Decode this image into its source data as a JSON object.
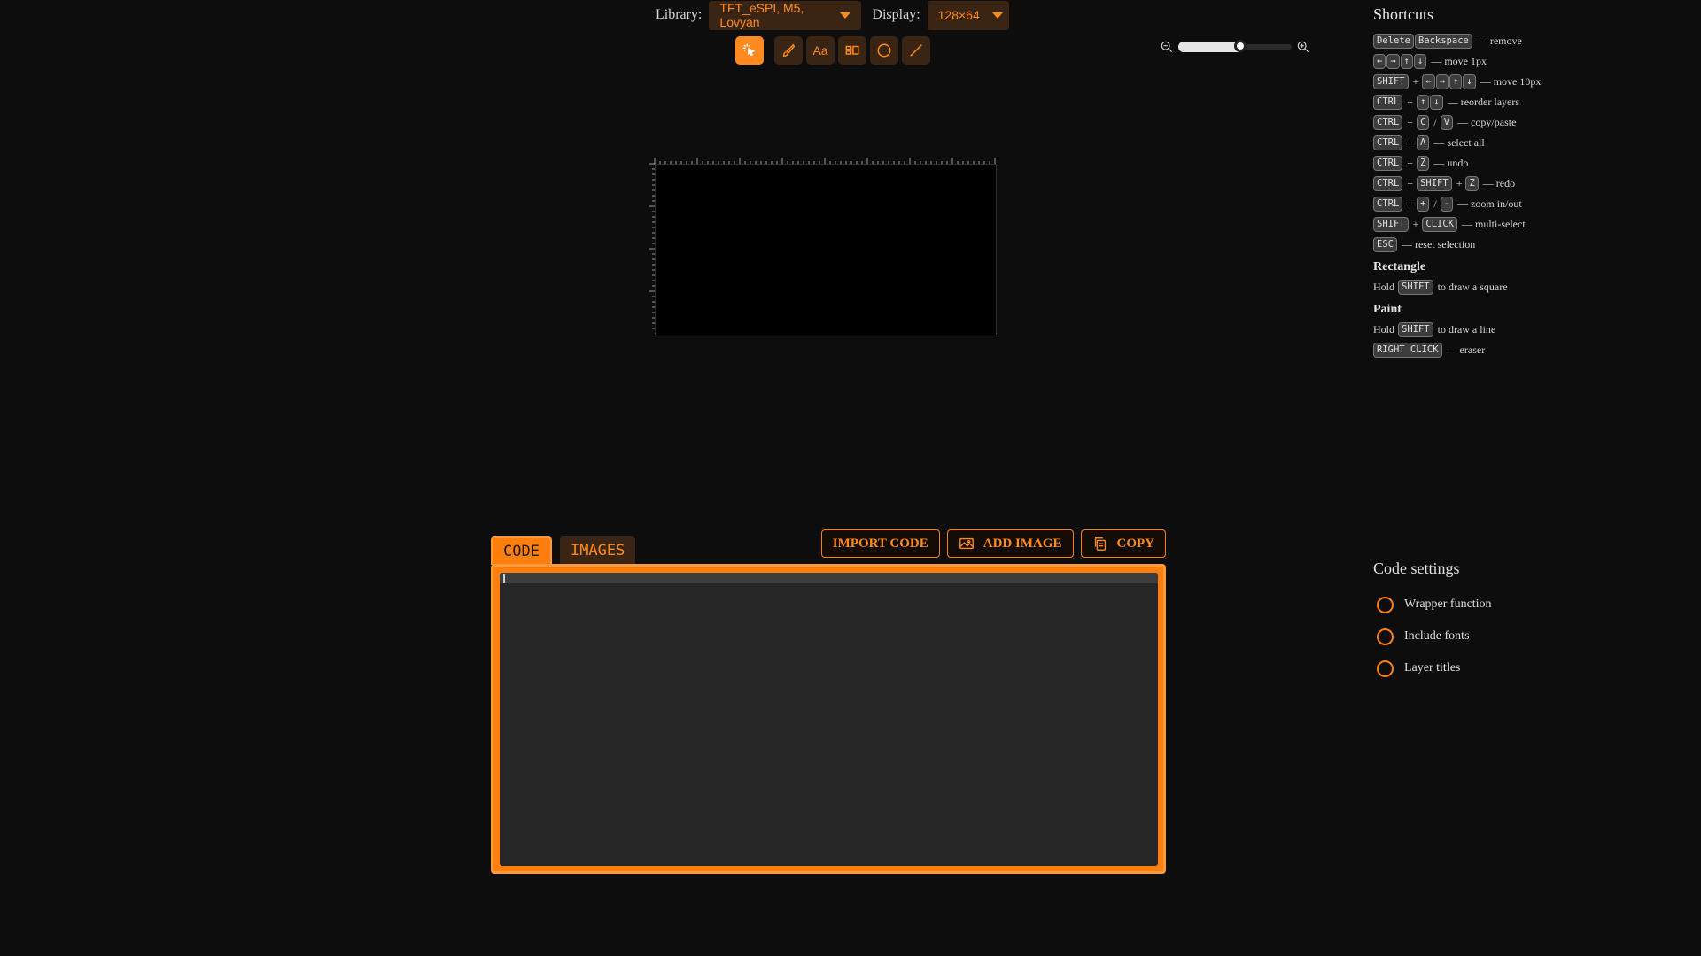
{
  "topbar": {
    "library_label": "Library:",
    "library_value": "TFT_eSPI, M5, Lovyan",
    "display_label": "Display:",
    "display_value": "128×64"
  },
  "tools": [
    {
      "name": "select-tool",
      "icon": "cursor-sparkle-icon",
      "active": true
    },
    {
      "name": "paint-tool",
      "icon": "brush-icon",
      "active": false
    },
    {
      "name": "text-tool",
      "icon": "text-icon",
      "label": "Aa",
      "active": false
    },
    {
      "name": "icon-tool",
      "icon": "shapes-icon",
      "active": false
    },
    {
      "name": "circle-tool",
      "icon": "circle-icon",
      "active": false
    },
    {
      "name": "line-tool",
      "icon": "line-icon",
      "active": false
    }
  ],
  "zoom": {
    "level": 0.55
  },
  "tabs": {
    "code": "CODE",
    "images": "IMAGES"
  },
  "actions": {
    "import": "IMPORT CODE",
    "add_image": "ADD IMAGE",
    "copy": "COPY"
  },
  "shortcuts": {
    "title": "Shortcuts",
    "lines": [
      {
        "keys": [
          "Delete",
          "Backspace"
        ],
        "desc": "— remove"
      },
      {
        "keys": [
          "←",
          "→",
          "↑",
          "↓"
        ],
        "desc": "— move 1px"
      },
      {
        "keys": [
          "SHIFT",
          "+",
          "←",
          "→",
          "↑",
          "↓"
        ],
        "desc": "— move 10px"
      },
      {
        "keys": [
          "CTRL",
          "+",
          "↑",
          "↓"
        ],
        "desc": "— reorder layers"
      },
      {
        "keys": [
          "CTRL",
          "+",
          "C",
          "/",
          "V"
        ],
        "desc": "— copy/paste"
      },
      {
        "keys": [
          "CTRL",
          "+",
          "A"
        ],
        "desc": "— select all"
      },
      {
        "keys": [
          "CTRL",
          "+",
          "Z"
        ],
        "desc": "— undo"
      },
      {
        "keys": [
          "CTRL",
          "+",
          "SHIFT",
          "+",
          "Z"
        ],
        "desc": "— redo"
      },
      {
        "keys": [
          "CTRL",
          "+",
          "+",
          "/",
          "-"
        ],
        "desc": "— zoom in/out"
      },
      {
        "keys": [
          "SHIFT",
          "+",
          "CLICK"
        ],
        "desc": "— multi-select"
      },
      {
        "keys": [
          "ESC"
        ],
        "desc": "— reset selection"
      }
    ],
    "rectangle": {
      "title": "Rectangle",
      "pre": "Hold",
      "key": "SHIFT",
      "post": "to draw a square"
    },
    "paint": {
      "title": "Paint",
      "line1": {
        "pre": "Hold",
        "key": "SHIFT",
        "post": "to draw a line"
      },
      "line2": {
        "key": "RIGHT CLICK",
        "post": "— eraser"
      }
    }
  },
  "settings": {
    "title": "Code settings",
    "options": [
      {
        "label": "Wrapper function",
        "checked": false
      },
      {
        "label": "Include fonts",
        "checked": false
      },
      {
        "label": "Layer titles",
        "checked": false
      }
    ]
  },
  "colors": {
    "accent": "#ff7f0e",
    "accent_dark": "#3a2414",
    "background": "#0d0d0d"
  }
}
